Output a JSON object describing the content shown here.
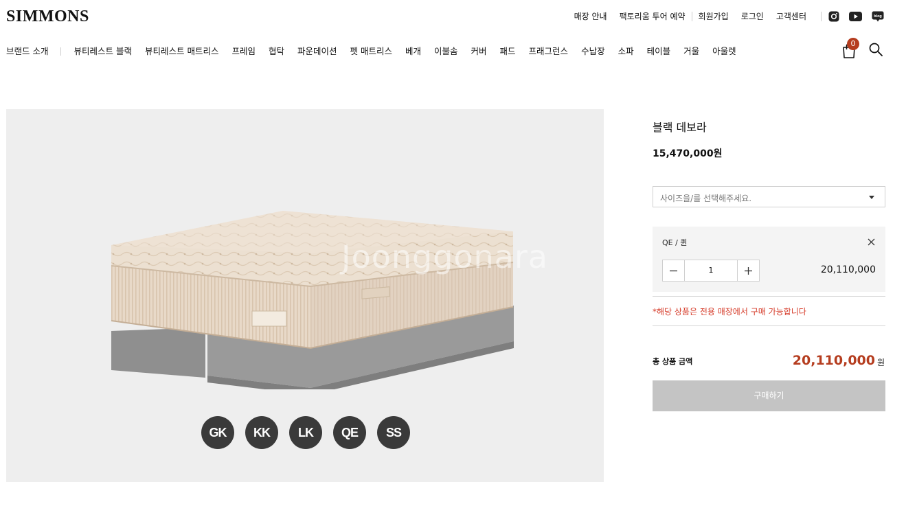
{
  "header": {
    "logo": "SIMMONS",
    "util_links": [
      "매장 안내",
      "팩토리움 투어 예약",
      "회원가입",
      "로그인",
      "고객센터"
    ],
    "social": [
      "instagram-icon",
      "youtube-icon",
      "blog-icon"
    ],
    "blog_label": "blog",
    "nav": [
      "브랜드 소개",
      "뷰티레스트 블랙",
      "뷰티레스트 매트리스",
      "프레임",
      "협탁",
      "파운데이션",
      "펫 매트리스",
      "베개",
      "이불솜",
      "커버",
      "패드",
      "프래그런스",
      "수납장",
      "소파",
      "테이블",
      "거울",
      "아울렛"
    ],
    "cart_count": "0"
  },
  "gallery": {
    "watermark": "Joonggonara",
    "size_chips": [
      "GK",
      "KK",
      "LK",
      "QE",
      "SS"
    ]
  },
  "product": {
    "name": "블랙 데보라",
    "price": "15,470,000원",
    "size_placeholder": "사이즈을/를 선택해주세요.",
    "selected_option": {
      "name": "QE / 퀸",
      "quantity": "1",
      "price": "20,110,000"
    },
    "notice": "*해당 상품은 전용 매장에서 구매 가능합니다",
    "total_label": "총 상품 금액",
    "total_amount": "20,110,000",
    "total_unit": "원",
    "buy_label": "구매하기"
  },
  "colors": {
    "accent": "#b53d1f",
    "notice": "#d63c2a",
    "disabled_button": "#c4c4c4",
    "image_bg": "#eeeeee"
  }
}
